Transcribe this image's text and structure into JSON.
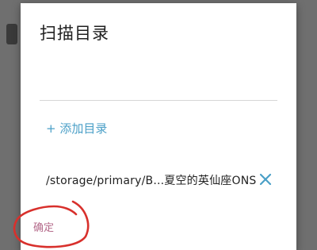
{
  "dialog": {
    "title": "扫描目录",
    "add_directory_label": "+ 添加目录",
    "directories": [
      {
        "path": "/storage/primary/B...夏空的英仙座ONS"
      }
    ],
    "confirm_label": "确定"
  },
  "colors": {
    "accent": "#4a9fc7",
    "confirm_text": "#b46a8a",
    "annotation": "#d8302c",
    "overlay": "#6f6f6f"
  },
  "icons": {
    "remove": "close-icon"
  }
}
